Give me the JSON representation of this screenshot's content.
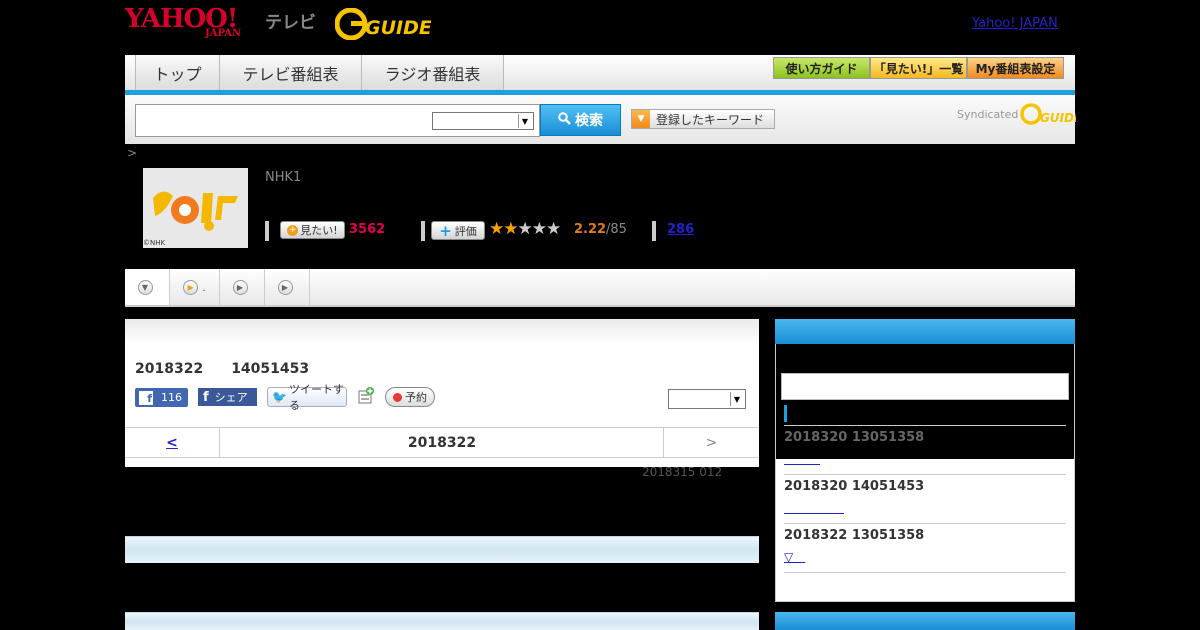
{
  "header": {
    "yahoo_logo": "YAHOO!",
    "japan_logo": "JAPAN",
    "tv_label": "テレビ",
    "gguide_logo": "G-GUIDE",
    "yahoo_japan_link": "Yahoo! JAPAN"
  },
  "nav": {
    "tabs": [
      "トップ",
      "テレビ番組表",
      "ラジオ番組表"
    ],
    "buttons": [
      "使い方ガイド",
      "「見たい!」一覧",
      "My番組表設定"
    ]
  },
  "search": {
    "button_label": "検索",
    "keyword_button": "登録したキーワード",
    "syndicated": "Syndicated"
  },
  "breadcrumb": ">",
  "program": {
    "thumb_credit": "©NHK",
    "channel": "NHK1",
    "mitai_label": "見たい!",
    "mitai_count": "3562",
    "hyoka_label": "評価",
    "rating": 2.22,
    "rating_text": "2.22",
    "rating_count": "/85",
    "comment_count": "286"
  },
  "tabs": {
    "tab2_label": "."
  },
  "main": {
    "date_line": "2018322　　14051453",
    "fb_like_count": "116",
    "fb_share": "シェア",
    "tweet": "ツイートする",
    "yoyaku": "予約",
    "prev": "<",
    "current_date": "2018322",
    "next": ">",
    "rebroadcast": "2018315  012"
  },
  "sidebar": {
    "entries": [
      {
        "date": "2018320  13051358",
        "link": "　　　"
      },
      {
        "date": "2018320  14051453",
        "link": "　　　　　"
      },
      {
        "date": "2018322  13051358",
        "link": "▽　"
      }
    ]
  },
  "colors": {
    "accent_blue": "#1e9fe0",
    "yahoo_red": "#d8002a",
    "mitai_pink": "#e00050",
    "score_orange": "#e07a1e",
    "link_blue": "#2222cc"
  }
}
